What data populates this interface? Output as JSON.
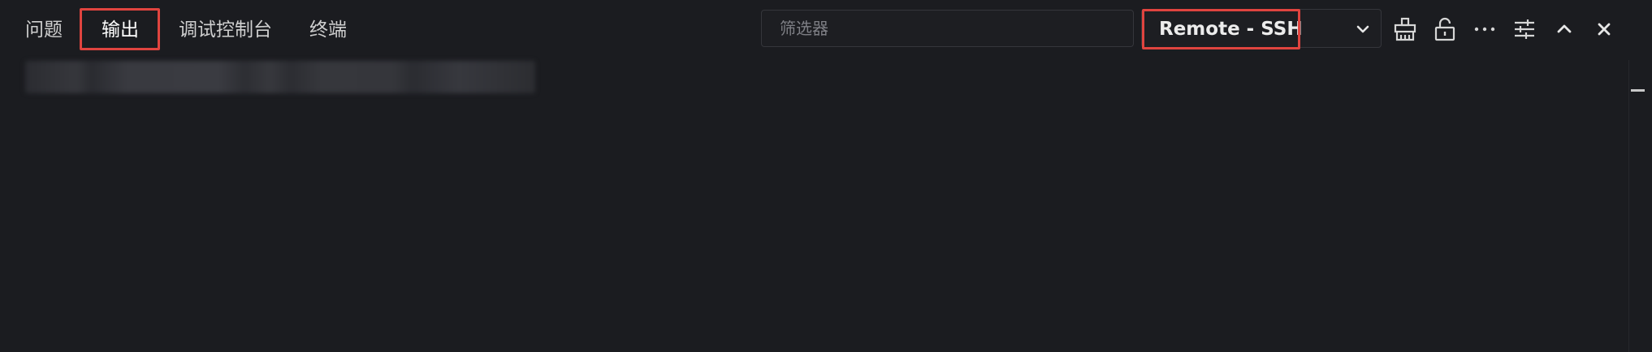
{
  "tabs": [
    {
      "label": "问题"
    },
    {
      "label": "输出"
    },
    {
      "label": "调试控制台"
    },
    {
      "label": "终端"
    }
  ],
  "active_tab": "输出",
  "filter": {
    "placeholder": "筛选器",
    "value": ""
  },
  "channel_select": {
    "value": "Remote - SSH"
  },
  "actions": [
    {
      "icon": "clear-output-icon"
    },
    {
      "icon": "lock-scroll-icon"
    },
    {
      "icon": "more-actions-icon"
    },
    {
      "icon": "settings-icon"
    },
    {
      "icon": "maximize-panel-icon"
    },
    {
      "icon": "close-panel-icon"
    }
  ],
  "colors": {
    "background": "#1b1c20",
    "highlight_border": "#e0443f",
    "text": "#cfcfcf"
  }
}
